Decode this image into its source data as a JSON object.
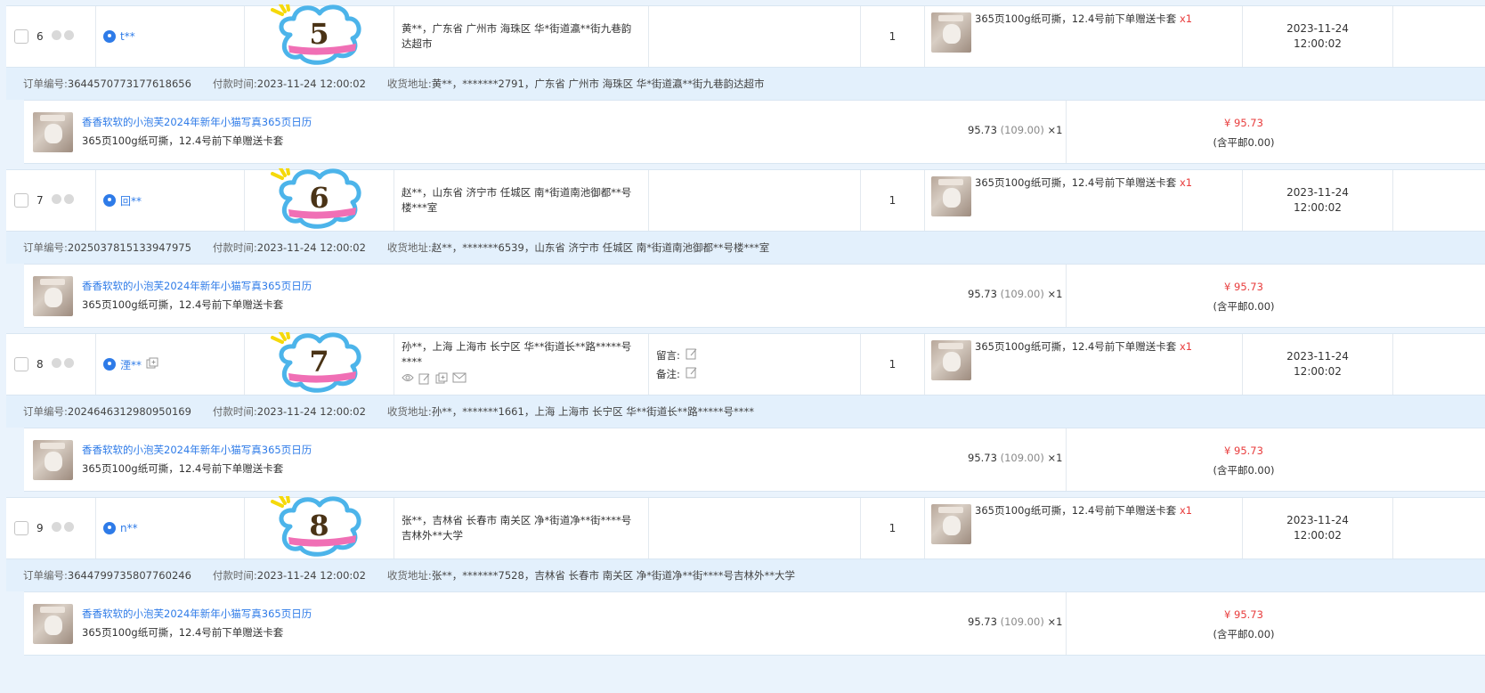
{
  "colors": {
    "accent": "#2e7be8",
    "price_red": "#e83c3c",
    "info_bg": "#e3f0fc",
    "page_bg": "#eaf3fc"
  },
  "orders": [
    {
      "index": "6",
      "user": "t**",
      "sticker": "5",
      "show_copy_icon": false,
      "address": "黄**，广东省 广州市 海珠区 华*街道瀛**街九巷韵达超市",
      "has_notes": false,
      "qty": "1",
      "product_spec": "365页100g纸可撕，12.4号前下单赠送卡套",
      "product_qty": "x1",
      "time_date": "2023-11-24",
      "time_clock": "12:00:02",
      "order_no_label": "订单编号:",
      "order_no": "3644570773177618656",
      "pay_time_label": "付款时间:",
      "pay_time": "2023-11-24 12:00:02",
      "ship_addr_label": "收货地址:",
      "ship_addr": "黄**，*******2791，广东省 广州市 海珠区 华*街道瀛**街九巷韵达超市",
      "item_title": "香香软软的小泡芙2024年新年小猫写真365页日历",
      "item_spec": "365页100g纸可撕，12.4号前下单赠送卡套",
      "item_price": "95.73",
      "item_orig": "(109.00)",
      "item_qty": "×1",
      "total": "¥ 95.73",
      "shipping": "(含平邮0.00)"
    },
    {
      "index": "7",
      "user": "回**",
      "sticker": "6",
      "show_copy_icon": false,
      "address": "赵**，山东省 济宁市 任城区 南*街道南池御都**号楼***室",
      "has_notes": false,
      "qty": "1",
      "product_spec": "365页100g纸可撕，12.4号前下单赠送卡套",
      "product_qty": "x1",
      "time_date": "2023-11-24",
      "time_clock": "12:00:02",
      "order_no_label": "订单编号:",
      "order_no": "2025037815133947975",
      "pay_time_label": "付款时间:",
      "pay_time": "2023-11-24 12:00:02",
      "ship_addr_label": "收货地址:",
      "ship_addr": "赵**，*******6539，山东省 济宁市 任城区 南*街道南池御都**号楼***室",
      "item_title": "香香软软的小泡芙2024年新年小猫写真365页日历",
      "item_spec": "365页100g纸可撕，12.4号前下单赠送卡套",
      "item_price": "95.73",
      "item_orig": "(109.00)",
      "item_qty": "×1",
      "total": "¥ 95.73",
      "shipping": "(含平邮0.00)"
    },
    {
      "index": "8",
      "user": "湮**",
      "sticker": "7",
      "show_copy_icon": true,
      "address": "孙**，上海 上海市 长宁区 华**街道长**路*****号****",
      "has_notes": true,
      "note_msg_label": "留言:",
      "note_remark_label": "备注:",
      "qty": "1",
      "product_spec": "365页100g纸可撕，12.4号前下单赠送卡套",
      "product_qty": "x1",
      "time_date": "2023-11-24",
      "time_clock": "12:00:02",
      "order_no_label": "订单编号:",
      "order_no": "2024646312980950169",
      "pay_time_label": "付款时间:",
      "pay_time": "2023-11-24 12:00:02",
      "ship_addr_label": "收货地址:",
      "ship_addr": "孙**，*******1661，上海 上海市 长宁区 华**街道长**路*****号****",
      "item_title": "香香软软的小泡芙2024年新年小猫写真365页日历",
      "item_spec": "365页100g纸可撕，12.4号前下单赠送卡套",
      "item_price": "95.73",
      "item_orig": "(109.00)",
      "item_qty": "×1",
      "total": "¥ 95.73",
      "shipping": "(含平邮0.00)"
    },
    {
      "index": "9",
      "user": "n**",
      "sticker": "8",
      "show_copy_icon": false,
      "address": "张**，吉林省 长春市 南关区 净*街道净**街****号吉林外**大学",
      "has_notes": false,
      "qty": "1",
      "product_spec": "365页100g纸可撕，12.4号前下单赠送卡套",
      "product_qty": "x1",
      "time_date": "2023-11-24",
      "time_clock": "12:00:02",
      "order_no_label": "订单编号:",
      "order_no": "3644799735807760246",
      "pay_time_label": "付款时间:",
      "pay_time": "2023-11-24 12:00:02",
      "ship_addr_label": "收货地址:",
      "ship_addr": "张**，*******7528，吉林省 长春市 南关区 净*街道净**街****号吉林外**大学",
      "item_title": "香香软软的小泡芙2024年新年小猫写真365页日历",
      "item_spec": "365页100g纸可撕，12.4号前下单赠送卡套",
      "item_price": "95.73",
      "item_orig": "(109.00)",
      "item_qty": "×1",
      "total": "¥ 95.73",
      "shipping": "(含平邮0.00)"
    }
  ]
}
